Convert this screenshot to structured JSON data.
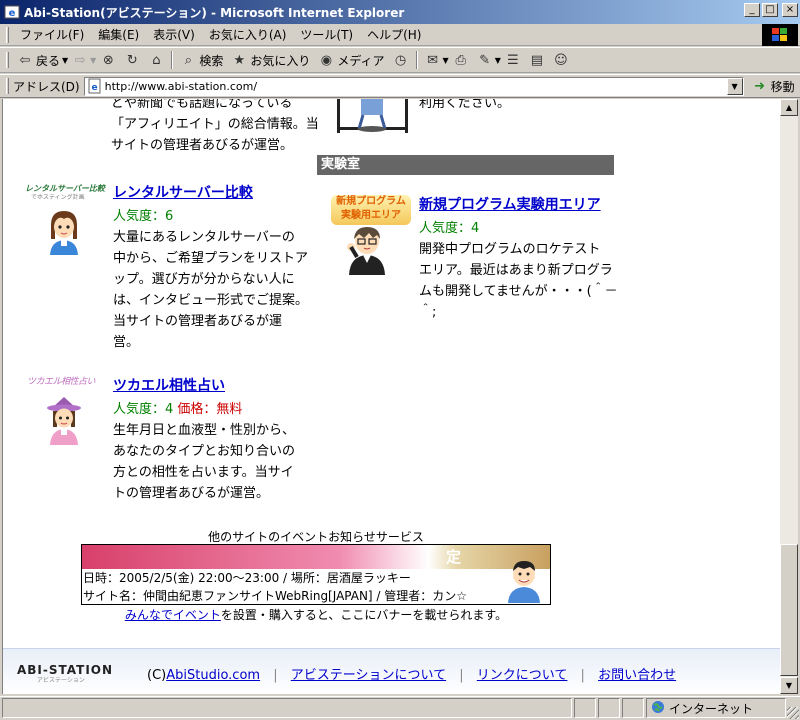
{
  "window": {
    "title": "Abi-Station(アビステーション) - Microsoft Internet Explorer",
    "btn_min": "_",
    "btn_max": "□",
    "btn_close": "×"
  },
  "menu": [
    "ファイル(F)",
    "編集(E)",
    "表示(V)",
    "お気に入り(A)",
    "ツール(T)",
    "ヘルプ(H)"
  ],
  "toolbar": {
    "back": "戻る",
    "search": "検索",
    "favorites": "お気に入り",
    "media": "メディア"
  },
  "address": {
    "label": "アドレス(D)",
    "url": "http://www.abi-station.com/",
    "go": "移動"
  },
  "content": {
    "top_left_lines": [
      "どや新聞でも話題になっている",
      "「アフィリエイト」の総合情報。当",
      "サイトの管理者あびるが運営。"
    ],
    "top_right_line": "利用ください。",
    "left_items": [
      {
        "logo_text": "レンタルサーバー比較",
        "logo_sub": "でホスティング計画",
        "title": "レンタルサーバー比較",
        "popularity": "人気度：6",
        "desc": [
          "大量にあるレンタルサーバーの",
          "中から、ご希望プランをリストア",
          "ップ。選び方が分からない人に",
          "は、インタビュー形式でご提案。",
          "当サイトの管理者あびるが運",
          "営。"
        ]
      },
      {
        "logo_text": "ツカエル相性占い",
        "title": "ツカエル相性占い",
        "popularity": "人気度：4",
        "price": "価格：無料",
        "desc": [
          "生年月日と血液型・性別から、",
          "あなたのタイプとお知り合いの",
          "方との相性を占います。当サイ",
          "トの管理者あびるが運営。"
        ]
      }
    ],
    "section_title": "実験室",
    "right_item": {
      "logo_line1": "新規プログラム",
      "logo_line2": "実験用エリア",
      "title": "新規プログラム実験用エリア",
      "popularity": "人気度：4",
      "desc": [
        "開発中プログラムのロケテスト",
        "エリア。最近はあまり新プログラ",
        "ムも開発してませんが・・・(＾－",
        "＾;"
      ]
    },
    "banner": {
      "caption": "他のサイトのイベントお知らせサービス",
      "top_char": "定",
      "line1": "日時：2005/2/5(金) 22:00～23:00 / 場所：居酒屋ラッキー",
      "line2": "サイト名：仲間由紀恵ファンサイトWebRing[JAPAN] / 管理者：カン☆",
      "note_link": "みんなでイベント",
      "note_rest": "を設置・購入すると、ここにバナーを載せられます。"
    },
    "footer": {
      "logo": "ABI-STATION",
      "logo_sub": "アビステーション",
      "copyright_prefix": "(C)",
      "copyright_link": "AbiStudio.com",
      "sep": "|",
      "links": [
        "アビステーションについて",
        "リンクについて",
        "お問い合わせ"
      ]
    }
  },
  "status": {
    "zone": "インターネット"
  },
  "colors": {
    "titlebar_start": "#0a246a",
    "titlebar_end": "#a6caf0",
    "link": "#0000cc",
    "popularity": "#008000",
    "price": "#cc0000",
    "section_bg": "#666666"
  }
}
